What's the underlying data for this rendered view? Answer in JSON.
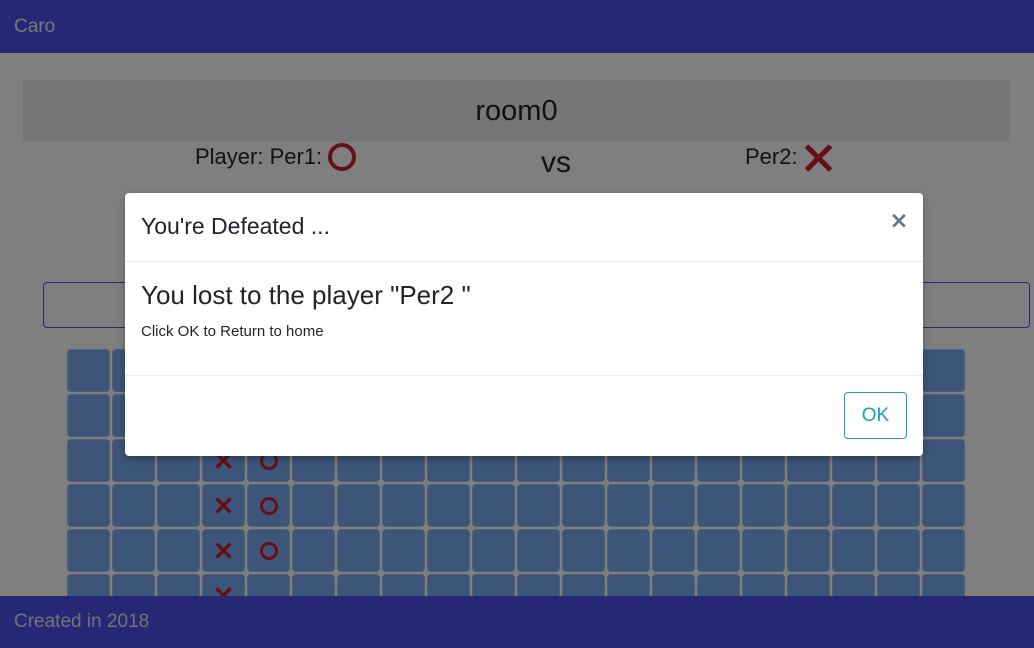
{
  "navbar": {
    "brand": "Caro"
  },
  "room": {
    "title": "room0"
  },
  "players": {
    "player1_label": "Player: Per1:",
    "player1_mark": "o-icon",
    "vs": "vs",
    "player2_label": "Per2:",
    "player2_mark": "x-icon"
  },
  "board": {
    "visible_rows": 6,
    "visible_columns": 20,
    "marks": [
      {
        "row": 2,
        "col": 3,
        "mark": "X"
      },
      {
        "row": 2,
        "col": 4,
        "mark": "O"
      },
      {
        "row": 3,
        "col": 3,
        "mark": "X"
      },
      {
        "row": 3,
        "col": 4,
        "mark": "O"
      },
      {
        "row": 4,
        "col": 3,
        "mark": "X"
      },
      {
        "row": 4,
        "col": 4,
        "mark": "O"
      },
      {
        "row": 5,
        "col": 3,
        "mark": "X"
      }
    ]
  },
  "footer": {
    "text": "Created in 2018"
  },
  "modal": {
    "title": "You're Defeated ...",
    "close_label": "×",
    "message": "You lost to the player \"Per2 \"",
    "instruction": "Click OK to Return to home",
    "ok_label": "OK"
  },
  "colors": {
    "navbar": "#4d4fea",
    "mark": "#cc1c33",
    "cell": "#7aaaf3",
    "ok_button": "#17a2b8"
  }
}
